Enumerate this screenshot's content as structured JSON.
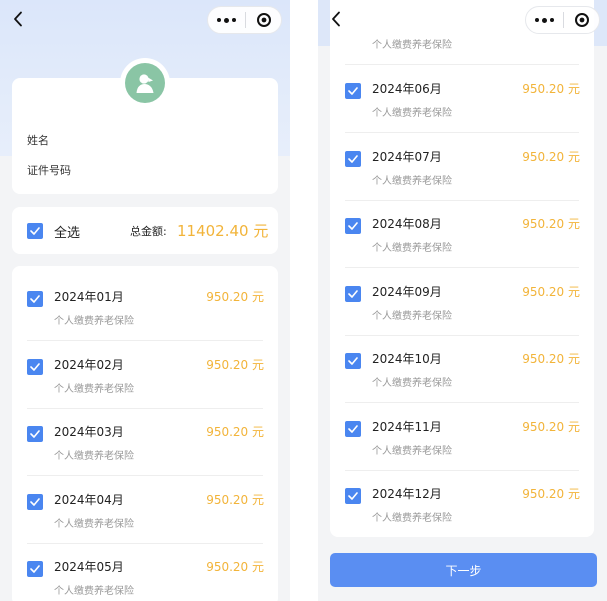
{
  "colors": {
    "accent": "#4a86f0",
    "amount": "#f2b43a",
    "hero_bg": "#dbe6fa",
    "page_bg": "#f3f4f6",
    "avatar_bg": "#8ac5a5",
    "button_bg": "#5a8ef2"
  },
  "nav": {
    "back_icon": "chevron-left-icon",
    "more_icon": "more-dots-icon",
    "close_icon": "target-circle-icon"
  },
  "profile": {
    "avatar_icon": "person-silhouette-icon",
    "name_label": "姓名",
    "id_label": "证件号码"
  },
  "summary": {
    "select_all_label": "全选",
    "select_all_checked": true,
    "total_label": "总金额:",
    "total_value": "11402.40 元"
  },
  "left_list": [
    {
      "month": "2024年01月",
      "amount": "950.20 元",
      "desc": "个人缴费养老保险",
      "checked": true
    },
    {
      "month": "2024年02月",
      "amount": "950.20 元",
      "desc": "个人缴费养老保险",
      "checked": true
    },
    {
      "month": "2024年03月",
      "amount": "950.20 元",
      "desc": "个人缴费养老保险",
      "checked": true
    },
    {
      "month": "2024年04月",
      "amount": "950.20 元",
      "desc": "个人缴费养老保险",
      "checked": true
    },
    {
      "month": "2024年05月",
      "amount": "950.20 元",
      "desc": "个人缴费养老保险",
      "checked": true
    }
  ],
  "right_list": {
    "partial_desc": "个人缴费养老保险",
    "items": [
      {
        "month": "2024年06月",
        "amount": "950.20 元",
        "desc": "个人缴费养老保险",
        "checked": true
      },
      {
        "month": "2024年07月",
        "amount": "950.20 元",
        "desc": "个人缴费养老保险",
        "checked": true
      },
      {
        "month": "2024年08月",
        "amount": "950.20 元",
        "desc": "个人缴费养老保险",
        "checked": true
      },
      {
        "month": "2024年09月",
        "amount": "950.20 元",
        "desc": "个人缴费养老保险",
        "checked": true
      },
      {
        "month": "2024年10月",
        "amount": "950.20 元",
        "desc": "个人缴费养老保险",
        "checked": true
      },
      {
        "month": "2024年11月",
        "amount": "950.20 元",
        "desc": "个人缴费养老保险",
        "checked": true
      },
      {
        "month": "2024年12月",
        "amount": "950.20 元",
        "desc": "个人缴费养老保险",
        "checked": true
      }
    ]
  },
  "footer": {
    "next_label": "下一步"
  }
}
